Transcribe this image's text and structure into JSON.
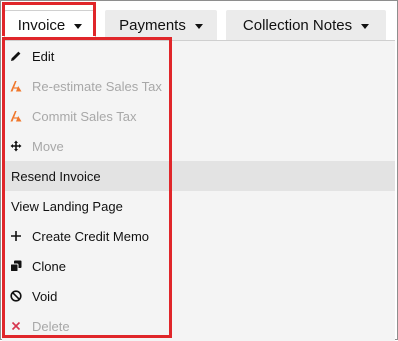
{
  "tabs": [
    {
      "label": "Invoice"
    },
    {
      "label": "Payments"
    },
    {
      "label": "Collection Notes"
    }
  ],
  "menu": {
    "items": [
      {
        "label": "Edit",
        "icon": "pencil-icon",
        "state": "enabled"
      },
      {
        "label": "Re-estimate Sales Tax",
        "icon": "avalara-logo-icon",
        "state": "disabled"
      },
      {
        "label": "Commit Sales Tax",
        "icon": "avalara-logo-icon",
        "state": "disabled"
      },
      {
        "label": "Move",
        "icon": "move-arrows-icon",
        "state": "disabled"
      },
      {
        "label": "Resend Invoice",
        "icon": "",
        "state": "selected"
      },
      {
        "label": "View Landing Page",
        "icon": "",
        "state": "enabled"
      },
      {
        "label": "Create Credit Memo",
        "icon": "plus-icon",
        "state": "enabled"
      },
      {
        "label": "Clone",
        "icon": "clone-icon",
        "state": "enabled"
      },
      {
        "label": "Void",
        "icon": "ban-icon",
        "state": "enabled"
      },
      {
        "label": "Delete",
        "icon": "delete-x-icon",
        "state": "disabled"
      }
    ]
  },
  "colors": {
    "highlight": "#e0262a",
    "menu_background": "#f4f4f4",
    "selected_row": "#e3e3e3",
    "disabled_text": "#a8a8a8",
    "tab_background": "#ebebeb"
  }
}
